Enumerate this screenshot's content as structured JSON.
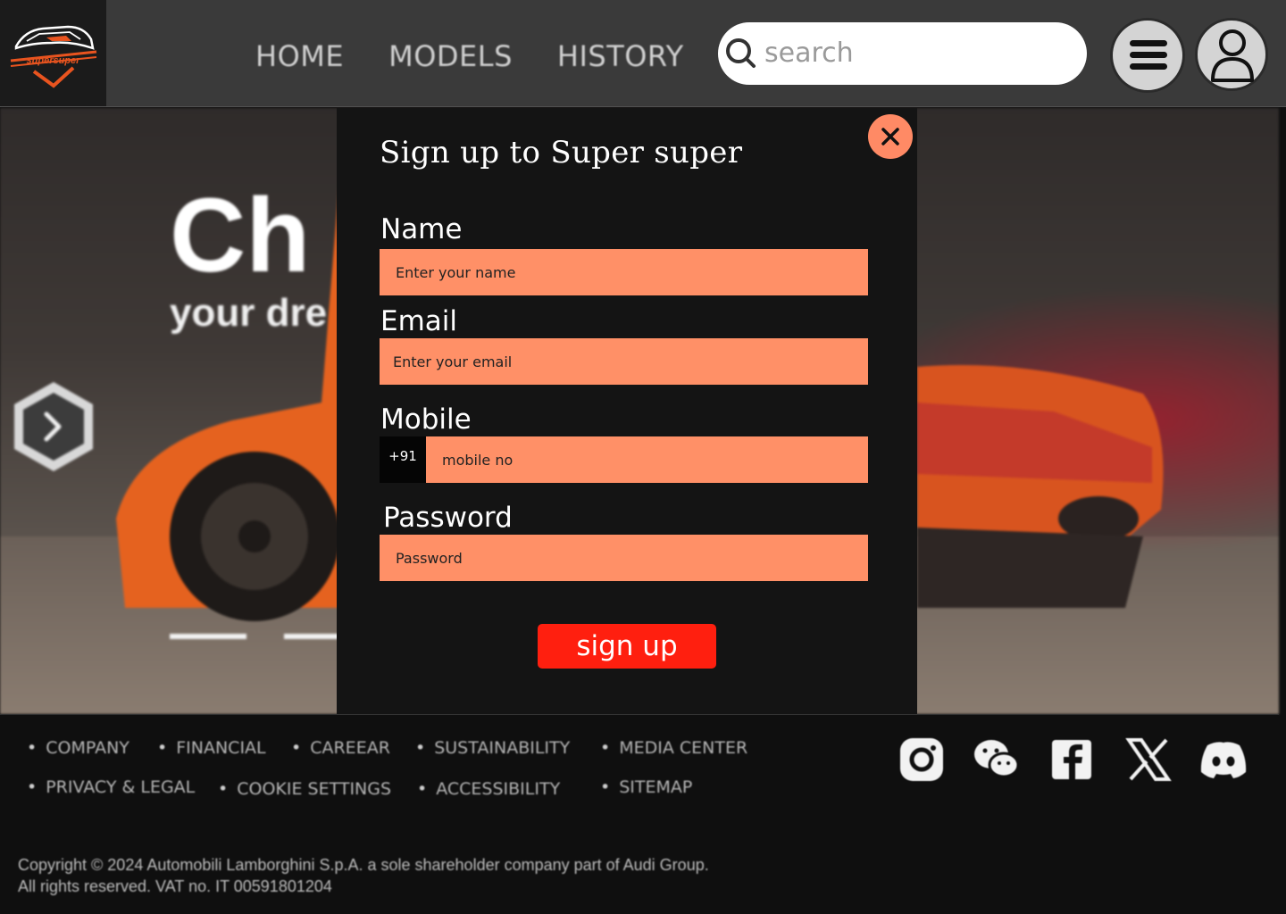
{
  "brand": {
    "logo_text": "supersuper",
    "accent": "#e9541f"
  },
  "nav": {
    "items": [
      {
        "label": "HOME"
      },
      {
        "label": "MODELS"
      },
      {
        "label": "HISTORY"
      }
    ]
  },
  "search": {
    "placeholder": "search",
    "icon": "search-icon"
  },
  "header_actions": {
    "menu_icon": "hamburger-menu-icon",
    "profile_icon": "user-profile-icon"
  },
  "hero": {
    "title": "Ch",
    "subtitle": "your dre",
    "next_icon": "chevron-right-icon",
    "slide_indicator_count": 2
  },
  "modal": {
    "title": "Sign up to Super super",
    "close_icon": "close-icon",
    "fields": {
      "name": {
        "label": "Name",
        "placeholder": "Enter your name"
      },
      "email": {
        "label": "Email",
        "placeholder": "Enter your email"
      },
      "mobile": {
        "label": "Mobile",
        "prefix": "+91",
        "placeholder": "mobile no"
      },
      "password": {
        "label": "Password",
        "placeholder": "Password"
      }
    },
    "submit_label": "sign up",
    "colors": {
      "background": "#141414",
      "field": "#ff9067",
      "button": "#ff1f0f",
      "close": "#ff8a65"
    }
  },
  "footer": {
    "links_row1": [
      "COMPANY",
      "FINANCIAL",
      "CAREEAR",
      "SUSTAINABILITY",
      "MEDIA CENTER"
    ],
    "links_row2": [
      "PRIVACY & LEGAL",
      "COOKIE SETTINGS",
      "ACCESSIBILITY",
      "SITEMAP"
    ],
    "social_icons": [
      "instagram-icon",
      "wechat-icon",
      "facebook-icon",
      "x-icon",
      "discord-icon"
    ],
    "copyright_line1": "Copyright © 2024 Automobili Lamborghini S.p.A. a sole shareholder company part of Audi Group.",
    "copyright_line2": "All rights reserved. VAT no. IT 00591801204"
  }
}
